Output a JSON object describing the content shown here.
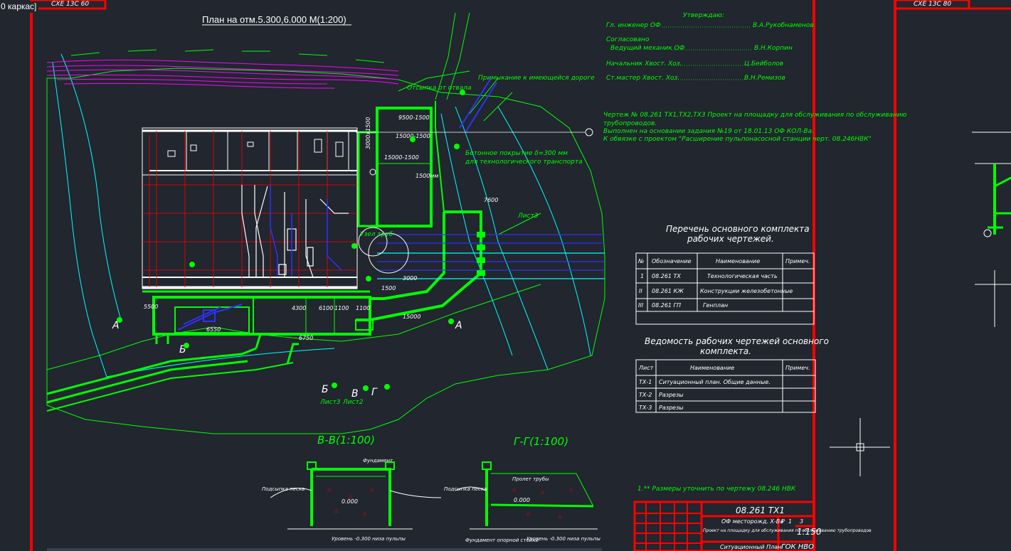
{
  "viewport": {
    "label": "0 каркас]"
  },
  "frame_stamps": {
    "left": "СХЕ 13С 60",
    "right": "СХЕ 13С 80"
  },
  "plan": {
    "title": "План на отм.5.300,6.000  М(1:200)",
    "annotations": [
      "Бетонное покрытие δ=300 мм",
      "для технологического транспорта",
      "Отсыпка от отвала",
      "Примыкание к имеющейся дороге",
      "Узел труб",
      "Лист3",
      "Лист2",
      "Лист3"
    ],
    "dims": [
      "9500-1500",
      "15000-1500",
      "15000-1500",
      "3000x1500",
      "1500мм",
      "6550",
      "4300",
      "6100",
      "1100",
      "1100",
      "6750",
      "7600",
      "1500",
      "3000",
      "5500",
      "15000"
    ],
    "sections": [
      "А",
      "А",
      "Б",
      "Б",
      "В",
      "Г"
    ]
  },
  "approval": {
    "heading": "Утверждаю:",
    "chief": {
      "role": "Гл. инженер ОФ",
      "name": "В.А.Рукобнаменов"
    },
    "agreed": "Согласовано",
    "rows": [
      {
        "role": "Ведущий механик ОФ",
        "name": "В.Н.Корпин"
      },
      {
        "role": "Начальник Хвост. Хоз.",
        "name": "Ц.Бейболов"
      },
      {
        "role": "Ст.мастер Хвост. Хоз.",
        "name": "В.Н.Ремизов"
      }
    ]
  },
  "note": {
    "lines": [
      "Чертеж № 08.261 ТХ1,ТХ2,ТХ3 Проект на площадку для обслуживания по обслуживанию",
      "трубопроводов.",
      "Выполнен на основании задания №19 от 18.01.13 ОФ КОЛ-Ва.",
      "К обвязке с проектом \"Расширение пульпонасосной станции черт. 08.246НВК\""
    ]
  },
  "main_set": {
    "title": "Перечень основного комплекта",
    "subtitle": "рабочих чертежей.",
    "headers": [
      "№",
      "Обозначение",
      "Наименование",
      "Примеч."
    ],
    "rows": [
      [
        "1",
        "08.261 ТХ",
        "Технологическая часть",
        ""
      ],
      [
        "II",
        "08.261 КЖ",
        "Конструкции железобетонные",
        ""
      ],
      [
        "III",
        "08.261 ГП",
        "Генплан",
        ""
      ]
    ]
  },
  "sheets": {
    "title": "Ведомость рабочих чертежей основного",
    "subtitle": "комплекта.",
    "headers": [
      "Лист",
      "Наименование",
      "Примеч."
    ],
    "rows": [
      [
        "ТХ-1",
        "Ситуационный план. Общие данные.",
        ""
      ],
      [
        "ТХ-2",
        "Разрезы",
        ""
      ],
      [
        "ТХ-3",
        "Разрезы",
        ""
      ]
    ]
  },
  "section_vv": {
    "title": "В-В(1:100)",
    "level": "0.000",
    "labels": [
      "Подсыпка песка",
      "Уровень -0.300 низа пульпы",
      "Фундамент"
    ]
  },
  "section_gg": {
    "title": "Г-Г(1:100)",
    "level": "0.000",
    "labels": [
      "Подсыпка песка",
      "Пролет трубы",
      "Фундамент опорной стойки",
      "Уровень -0.300 низа пульпы"
    ]
  },
  "footnote": "1.** Размеры уточнить по чертежу 08.246 НВК",
  "title_block": {
    "code": "08.261  ТХ1",
    "org": "ОФ месторожд. Х-Ва",
    "desc": "Проект на площадку для обслуживания по обслуживанию трубопроводов",
    "plan_name": "Ситуационный План",
    "scale": "1:150",
    "firm": "ГОК НВО",
    "stage": "Р",
    "sheet": "1",
    "sheets_total": "3"
  },
  "colors": {
    "background": "#21262f",
    "frame": "#ff0000",
    "green": "#00ff00",
    "cyan": "#00ffff",
    "white": "#ffffff",
    "blue": "#3030ff",
    "magenta": "#ff00ff",
    "yellow": "#ffff00"
  }
}
